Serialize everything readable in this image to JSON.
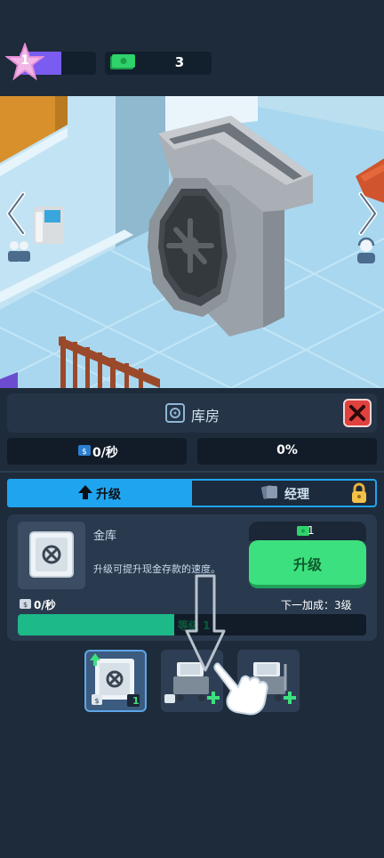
{
  "header": {
    "level": "1",
    "level_progress": 0.55,
    "cash": "3"
  },
  "room": {
    "title": "库房",
    "income_rate": "0/秒",
    "percent": "0%"
  },
  "tabs": [
    {
      "label": "升级",
      "active": true
    },
    {
      "label": "经理",
      "active": false,
      "locked": true
    }
  ],
  "upgrade_card": {
    "name": "金库",
    "description": "升级可提升现金存款的速度。",
    "cost": "1",
    "button_label": "升级",
    "rate": "0/秒",
    "next_bonus": "下一加成：3级",
    "progress_label": "等级 1",
    "progress": 0.45
  },
  "items": [
    {
      "name": "vault",
      "count": "1",
      "selected": true
    },
    {
      "name": "cash-cart-1",
      "selected": false
    },
    {
      "name": "cash-cart-2",
      "selected": false
    }
  ],
  "colors": {
    "accent_blue": "#1fa5f0",
    "accent_green": "#3de07e",
    "close_red": "#e0413f",
    "bg": "#1e2b3a"
  }
}
